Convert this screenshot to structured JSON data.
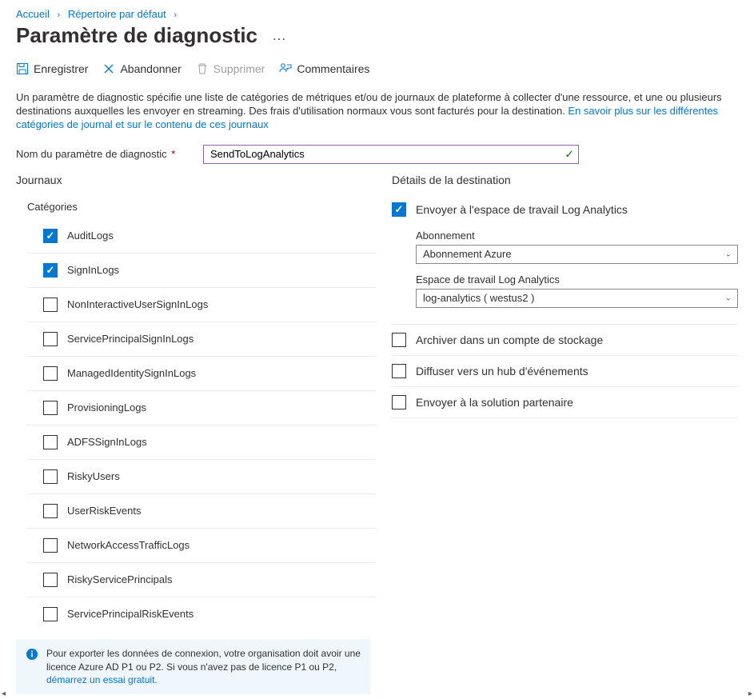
{
  "breadcrumb": {
    "items": [
      {
        "label": "Accueil"
      },
      {
        "label": "Répertoire par défaut"
      }
    ]
  },
  "page": {
    "title": "Paramètre de diagnostic",
    "more_label": "…"
  },
  "toolbar": {
    "save_label": "Enregistrer",
    "discard_label": "Abandonner",
    "delete_label": "Supprimer",
    "feedback_label": "Commentaires"
  },
  "description": {
    "text": "Un paramètre de diagnostic spécifie une liste de catégories de métriques et/ou de journaux de plateforme à collecter d'une ressource, et une ou plusieurs destinations auxquelles les envoyer en streaming. Des frais d'utilisation normaux vous sont facturés pour la destination. ",
    "link": "En savoir plus sur les différentes catégories de journal et sur le contenu de ces journaux"
  },
  "name_field": {
    "label": "Nom du paramètre de diagnostic",
    "required": "*",
    "value": "SendToLogAnalytics"
  },
  "logs": {
    "heading": "Journaux",
    "categories_label": "Catégories",
    "items": [
      {
        "label": "AuditLogs",
        "checked": true
      },
      {
        "label": "SignInLogs",
        "checked": true
      },
      {
        "label": "NonInteractiveUserSignInLogs",
        "checked": false
      },
      {
        "label": "ServicePrincipalSignInLogs",
        "checked": false
      },
      {
        "label": "ManagedIdentitySignInLogs",
        "checked": false
      },
      {
        "label": "ProvisioningLogs",
        "checked": false
      },
      {
        "label": "ADFSSignInLogs",
        "checked": false
      },
      {
        "label": "RiskyUsers",
        "checked": false
      },
      {
        "label": "UserRiskEvents",
        "checked": false
      },
      {
        "label": "NetworkAccessTrafficLogs",
        "checked": false
      },
      {
        "label": "RiskyServicePrincipals",
        "checked": false
      },
      {
        "label": "ServicePrincipalRiskEvents",
        "checked": false
      }
    ]
  },
  "destination": {
    "heading": "Détails de la destination",
    "log_analytics": {
      "label": "Envoyer à l'espace de travail Log Analytics",
      "checked": true,
      "subscription_label": "Abonnement",
      "subscription_value": "Abonnement Azure",
      "workspace_label": "Espace de travail Log Analytics",
      "workspace_value": "log-analytics ( westus2 )"
    },
    "storage": {
      "label": "Archiver dans un compte de stockage",
      "checked": false
    },
    "eventhub": {
      "label": "Diffuser vers un hub d'événements",
      "checked": false
    },
    "partner": {
      "label": "Envoyer à la solution partenaire",
      "checked": false
    }
  },
  "info": {
    "text": "Pour exporter les données de connexion, votre organisation doit avoir une licence Azure AD P1 ou P2. Si vous n'avez pas de licence P1 ou P2, ",
    "link": "démarrez un essai gratuit."
  }
}
